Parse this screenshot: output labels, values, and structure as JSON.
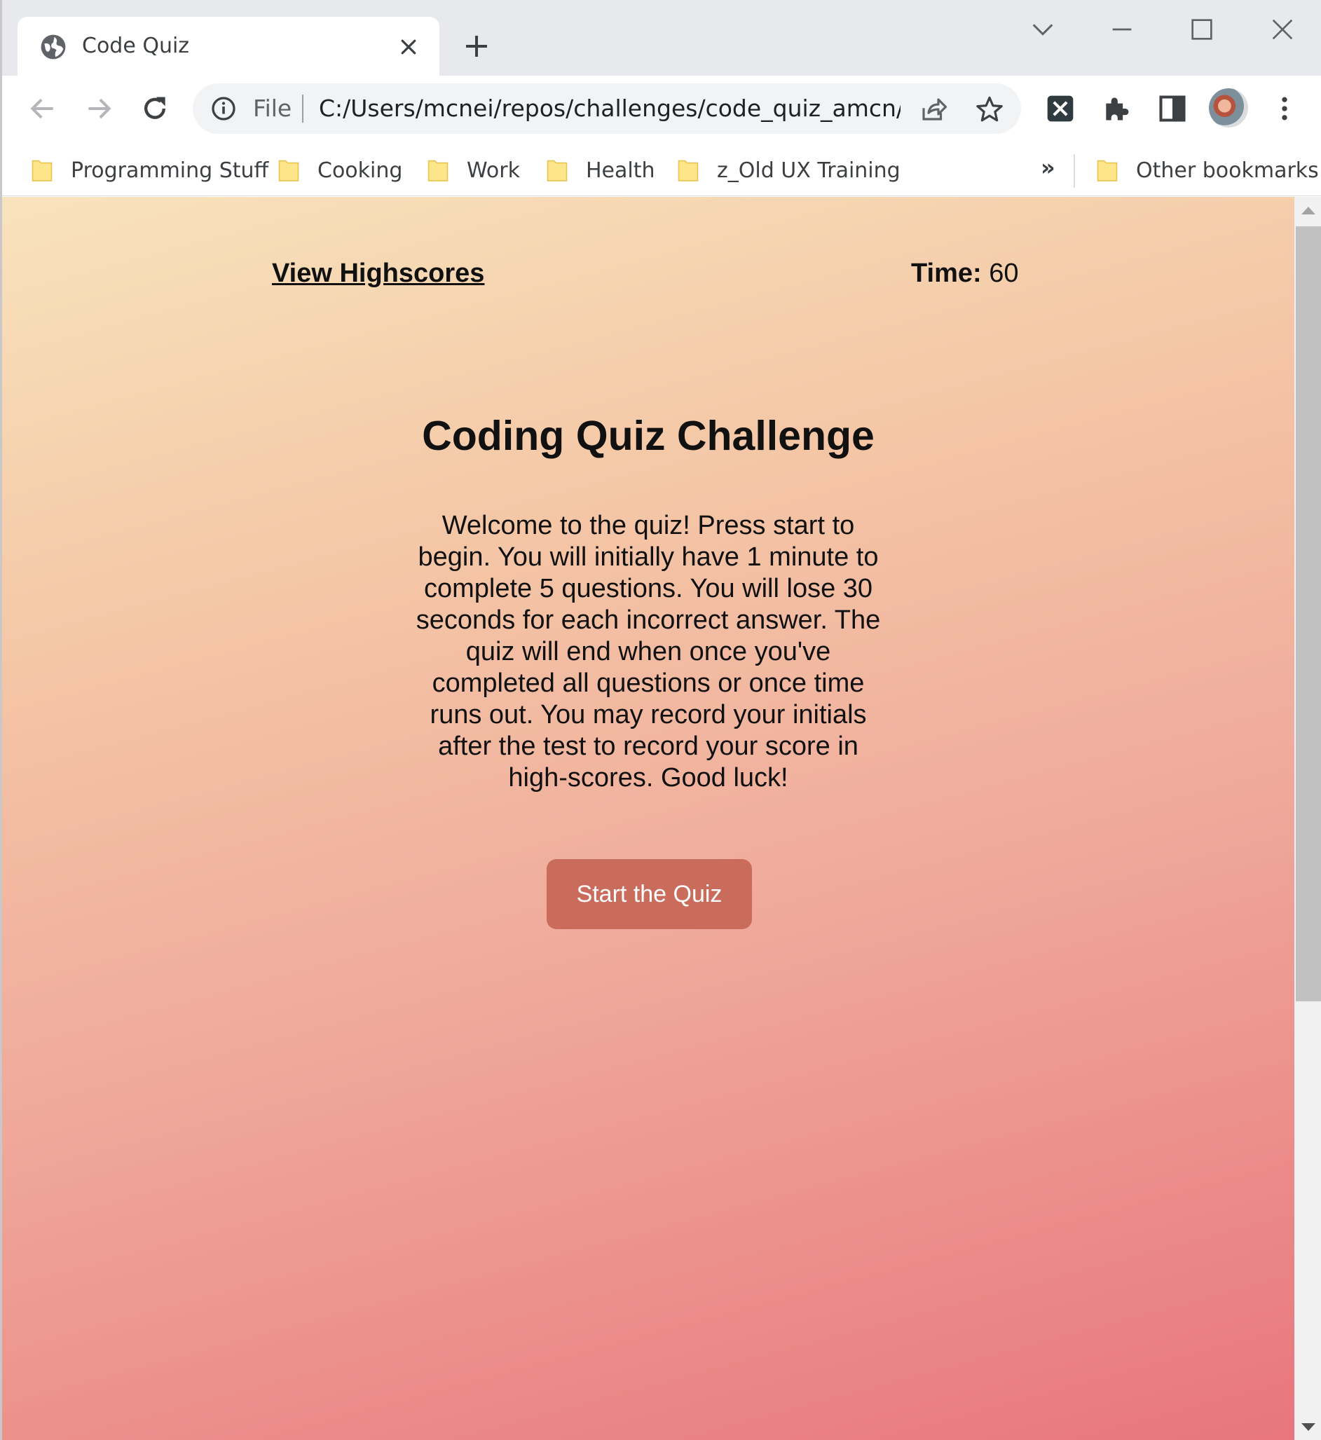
{
  "browser": {
    "tab": {
      "title": "Code Quiz",
      "icon": "globe-icon"
    },
    "omnibox": {
      "scheme_label": "File",
      "url": "C:/Users/mcnei/repos/challenges/code_quiz_amcn/i..."
    },
    "bookmarks": [
      {
        "label": "Programming Stuff"
      },
      {
        "label": "Cooking"
      },
      {
        "label": "Work"
      },
      {
        "label": "Health"
      },
      {
        "label": "z_Old UX Training"
      }
    ],
    "more_bookmarks": "»",
    "other_bookmarks": "Other bookmarks"
  },
  "page": {
    "highscores_link": "View Highscores",
    "timer": {
      "label": "Time:",
      "value": "60"
    },
    "title": "Coding Quiz Challenge",
    "intro": "Welcome to the quiz! Press start to begin. You will initially have 1 minute to complete 5 questions. You will lose 30 seconds for each incorrect answer. The quiz will end when once you've completed all questions or once time runs out. You may record your initials after the test to record your score in high-scores. Good luck!",
    "start_button": "Start the Quiz"
  },
  "colors": {
    "gradient_top": "#f8e3bc",
    "gradient_bottom": "#e8767c",
    "start_button": "#ca6c5c"
  }
}
